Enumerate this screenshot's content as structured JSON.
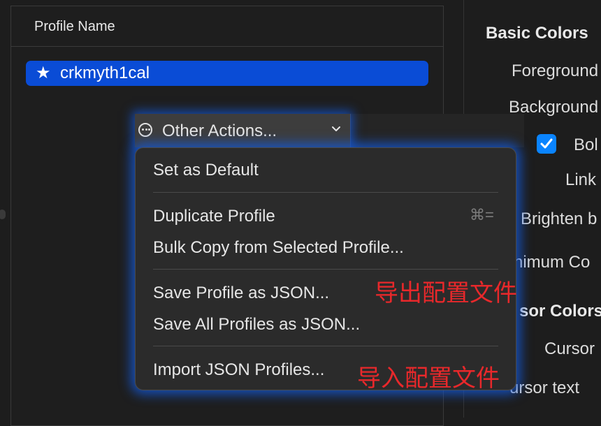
{
  "profiles": {
    "header": "Profile Name",
    "items": [
      {
        "name": "crkmyth1cal",
        "star_icon": "★",
        "selected": true
      }
    ]
  },
  "other_actions": {
    "label": "Other Actions...",
    "icon": "ellipsis-circle-icon",
    "chevron": "⌄"
  },
  "menu": {
    "items": [
      {
        "label": "Set as Default"
      },
      {
        "label": "Duplicate Profile",
        "shortcut": "⌘="
      },
      {
        "label": "Bulk Copy from Selected Profile..."
      },
      {
        "label": "Save Profile as JSON..."
      },
      {
        "label": "Save All Profiles as JSON..."
      },
      {
        "label": "Import JSON Profiles..."
      }
    ]
  },
  "annotations": {
    "export": "导出配置文件",
    "import": "导入配置文件"
  },
  "settings": {
    "basic_colors": "Basic Colors",
    "foreground": "Foreground",
    "background": "Background",
    "bold": "Bol",
    "link": "Link",
    "brighten": "Brighten b",
    "minimum_contrast": "nimum Co",
    "cursor_colors": "sor Colors",
    "cursor": "Cursor",
    "cursor_text": "ursor text"
  },
  "colors": {
    "selection": "#0a4cd6",
    "annotation": "#e8282b",
    "checkbox": "#0a84ff"
  }
}
